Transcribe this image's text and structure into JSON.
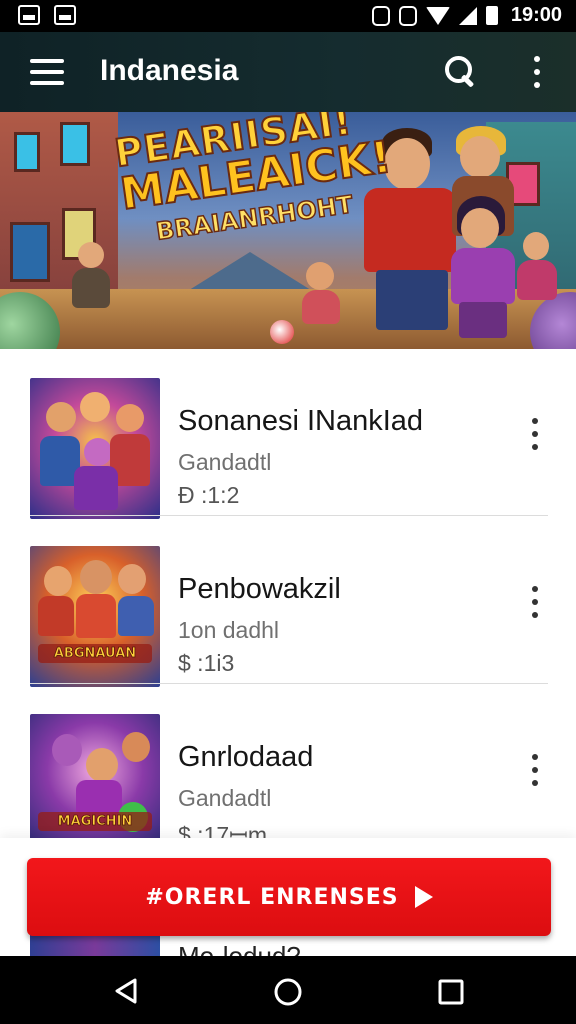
{
  "status_bar": {
    "time": "19:00",
    "icons": [
      "image-notification-icon",
      "gallery-notification-icon",
      "vibrate-icon",
      "nfc-icon",
      "wifi-icon",
      "signal-icon",
      "battery-icon"
    ]
  },
  "app_bar": {
    "title": "Indanesia",
    "icons": [
      "menu-icon",
      "search-icon",
      "more-vert-icon"
    ],
    "color": "#12262a"
  },
  "banner": {
    "line1": "PEARIISAI!",
    "line2": "MALEAICK!",
    "line3": "BRAIANRHOHT"
  },
  "list": {
    "items": [
      {
        "title": "Sonanesi INankIad",
        "subtitle": "Gandadtl",
        "price": "Ɖ :1:2",
        "thumb_label": ""
      },
      {
        "title": "Penbowakzil",
        "subtitle": "1on dadhl",
        "price": "$ :1i3",
        "thumb_label": "ABGNAUAN"
      },
      {
        "title": "Gnrlodaad",
        "subtitle": "Gandadtl",
        "price": "$ :17ꟷm",
        "thumb_label": "MAGICHIN"
      }
    ],
    "peek_title": "Mo·lodud?"
  },
  "cta": {
    "label": "#ORERL ENRENSES",
    "color": "#e81216"
  },
  "nav_bar": {
    "icons": [
      "back-icon",
      "home-icon",
      "recents-icon"
    ]
  }
}
